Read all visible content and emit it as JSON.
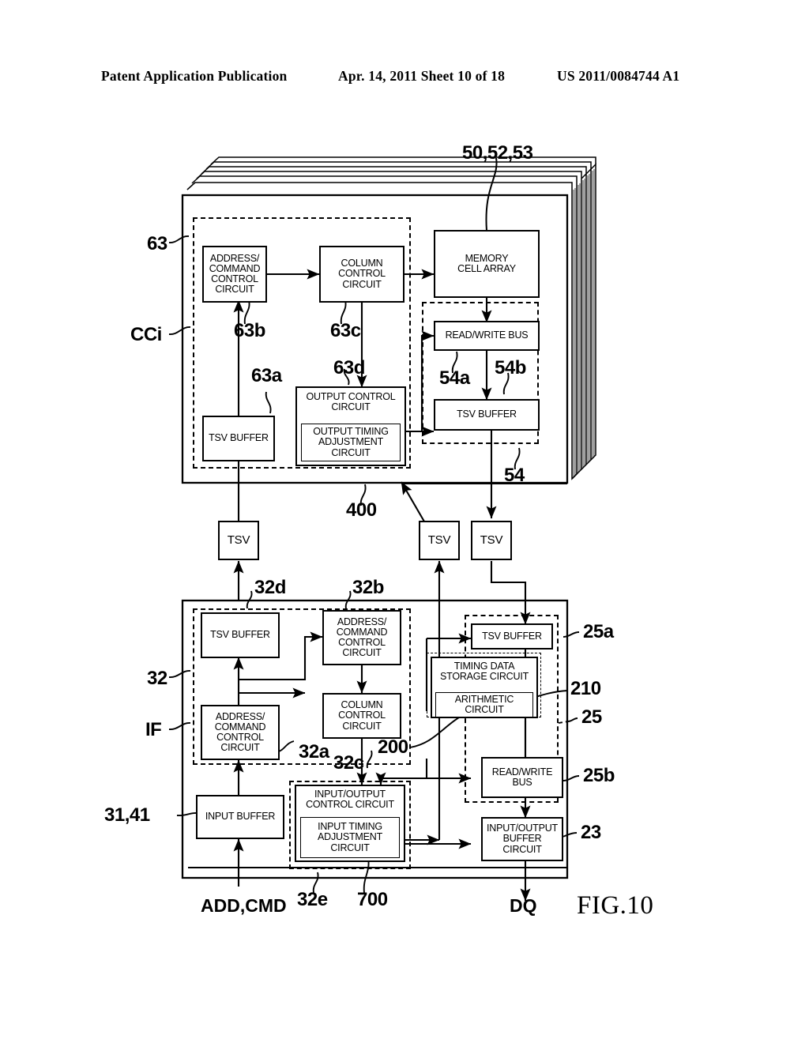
{
  "header": {
    "title": "Patent Application Publication",
    "date_sheet": "Apr. 14, 2011  Sheet 10 of 18",
    "pub_number": "US 2011/0084744 A1"
  },
  "figure": {
    "caption": "FIG.10",
    "upper_die": {
      "stack_ref": "50,52,53",
      "group_ref_left": "63",
      "group_ref_left2": "CCi",
      "blocks": [
        {
          "id": "u-addr-cmd",
          "label": "ADDRESS/\nCOMMAND\nCONTROL\nCIRCUIT",
          "ref": "63b"
        },
        {
          "id": "u-col",
          "label": "COLUMN\nCONTROL\nCIRCUIT",
          "ref": "63c"
        },
        {
          "id": "u-mem",
          "label": "MEMORY\nCELL ARRAY",
          "ref": "50,52,53"
        },
        {
          "id": "u-rwbus",
          "label": "READ/WRITE BUS",
          "ref": "54a"
        },
        {
          "id": "u-tsvbuf-r",
          "label": "TSV BUFFER",
          "ref": "54b"
        },
        {
          "id": "u-tsvbuf-l",
          "label": "TSV BUFFER",
          "ref": "63a"
        },
        {
          "id": "u-outctl",
          "label": "OUTPUT CONTROL\nCIRCUIT",
          "ref": "63d"
        },
        {
          "id": "u-outtim",
          "label": "OUTPUT TIMING\nADJUSTMENT\nCIRCUIT",
          "ref": "400"
        }
      ],
      "refs": {
        "r63b": "63b",
        "r63c": "63c",
        "r63d": "63d",
        "r63a": "63a",
        "r54a": "54a",
        "r54b": "54b",
        "r54": "54",
        "r400": "400"
      }
    },
    "tsv_row": [
      {
        "id": "tsv-left",
        "label": "TSV"
      },
      {
        "id": "tsv-mid",
        "label": "TSV"
      },
      {
        "id": "tsv-right",
        "label": "TSV"
      }
    ],
    "lower_die": {
      "group_ref_left": "32",
      "group_ref_left2": "IF",
      "group_ref_left3": "31,41",
      "blocks": [
        {
          "id": "l-tsvbuf",
          "label": "TSV BUFFER",
          "ref": "32d"
        },
        {
          "id": "l-addr-top",
          "label": "ADDRESS/\nCOMMAND\nCONTROL\nCIRCUIT",
          "ref": "32b"
        },
        {
          "id": "l-addr-bot",
          "label": "ADDRESS/\nCOMMAND\nCONTROL\nCIRCUIT",
          "ref": "32a"
        },
        {
          "id": "l-col",
          "label": "COLUMN\nCONTROL\nCIRCUIT",
          "ref": "32c"
        },
        {
          "id": "l-inbuf",
          "label": "INPUT BUFFER",
          "ref": "31,41"
        },
        {
          "id": "l-ioctl",
          "label": "INPUT/OUTPUT\nCONTROL CIRCUIT",
          "ref": "32e"
        },
        {
          "id": "l-intim",
          "label": "INPUT TIMING\nADJUSTMENT\nCIRCUIT",
          "ref": "700"
        },
        {
          "id": "l-tsvbuf-r",
          "label": "TSV BUFFER",
          "ref": "25a"
        },
        {
          "id": "l-timdata",
          "label": "TIMING DATA\nSTORAGE CIRCUIT",
          "ref": "200"
        },
        {
          "id": "l-arith",
          "label": "ARITHMETIC\nCIRCUIT",
          "ref": "210"
        },
        {
          "id": "l-rwbus",
          "label": "READ/WRITE\nBUS",
          "ref": "25b"
        },
        {
          "id": "l-iobuf",
          "label": "INPUT/OUTPUT\nBUFFER\nCIRCUIT",
          "ref": "23"
        }
      ],
      "refs": {
        "r32d": "32d",
        "r32b": "32b",
        "r32a": "32a",
        "r32c": "32c",
        "r32e": "32e",
        "r700": "700",
        "r200": "200",
        "r210": "210",
        "r25": "25",
        "r25a": "25a",
        "r25b": "25b",
        "r23": "23"
      }
    },
    "signals": {
      "input": "ADD,CMD",
      "output": "DQ"
    }
  },
  "colors": {
    "ink": "#000000",
    "paper": "#ffffff"
  }
}
